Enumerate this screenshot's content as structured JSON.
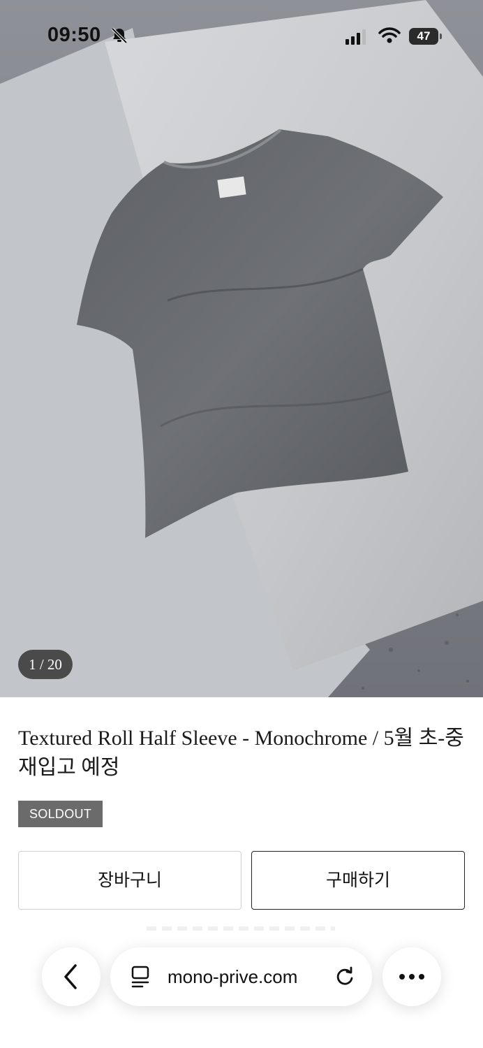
{
  "status_bar": {
    "time": "09:50",
    "battery": "47"
  },
  "gallery": {
    "counter": "1 / 20"
  },
  "product": {
    "title": "Textured Roll Half Sleeve - Monochrome / 5월 초-중 재입고 예정",
    "badge": "SOLDOUT"
  },
  "actions": {
    "cart_label": "장바구니",
    "buy_label": "구매하기"
  },
  "browser": {
    "url": "mono-prive.com",
    "icons": [
      "back-arrow-icon",
      "page-icon",
      "reload-icon",
      "more-icon"
    ]
  },
  "colors": {
    "badge_bg": "#6b6b6b",
    "buy_border": "#222222",
    "cart_border": "#cfcfcf"
  }
}
